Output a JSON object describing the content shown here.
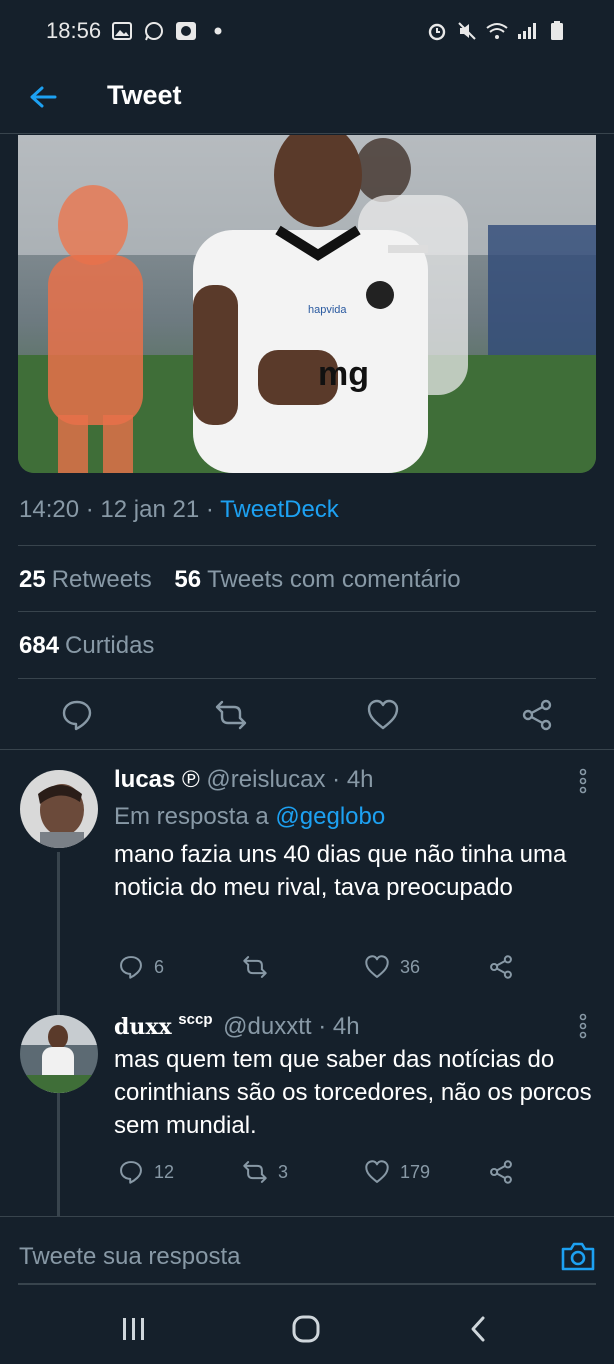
{
  "status_bar": {
    "time": "18:56",
    "left_icons": [
      "image-icon",
      "whatsapp-icon",
      "app-icon",
      "dot-icon"
    ],
    "right_icons": [
      "alarm-icon",
      "mute-icon",
      "wifi-icon",
      "signal-icon",
      "battery-icon"
    ]
  },
  "header": {
    "title": "Tweet"
  },
  "tweet": {
    "time": "14:20",
    "date": "12 jan 21",
    "source": "TweetDeck",
    "retweets_count": "25",
    "retweets_label": "Retweets",
    "quotes_count": "56",
    "quotes_label": "Tweets com comentário",
    "likes_count": "684",
    "likes_label": "Curtidas"
  },
  "replies": [
    {
      "name": "lucas",
      "badge": "℗",
      "handle": "@reislucax",
      "age": "4h",
      "reply_to_label": "Em resposta a",
      "reply_to_user": "@geglobo",
      "text": "mano fazia uns 40 dias que não tinha uma noticia do meu rival, tava preocupado",
      "replies": "6",
      "retweets": "",
      "likes": "36"
    },
    {
      "name": "duxx",
      "name_suffix": "sccp",
      "handle": "@duxxtt",
      "age": "4h",
      "text": "mas quem tem que saber das notícias do corinthians são os torcedores, não os porcos sem mundial.",
      "replies": "12",
      "retweets": "3",
      "likes": "179"
    }
  ],
  "compose": {
    "placeholder": "Tweete sua resposta"
  },
  "colors": {
    "background": "#15202b",
    "accent": "#1da1f2",
    "muted": "#8899a6",
    "divider": "#38444d"
  }
}
